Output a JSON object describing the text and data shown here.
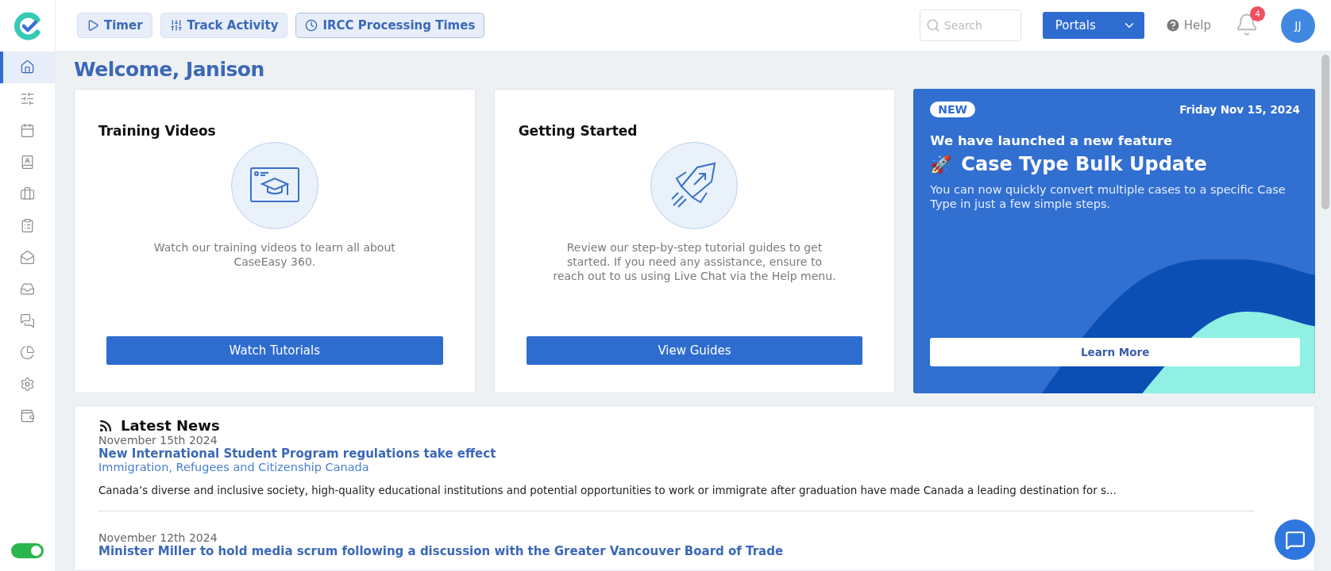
{
  "topbar": {
    "buttons": [
      {
        "kind": "timer",
        "label": "Timer"
      },
      {
        "kind": "activity",
        "label": "Track Activity"
      },
      {
        "kind": "clock",
        "label": "IRCC Processing Times"
      }
    ],
    "search": {
      "placeholder": "Search"
    },
    "portals": {
      "label": "Portals"
    },
    "help": {
      "label": "Help"
    },
    "notifications": {
      "count": "4"
    },
    "avatar": {
      "initials": "JJ"
    }
  },
  "sidebar": {
    "items": [
      {
        "kind": "home",
        "selected": true
      },
      {
        "kind": "sliders",
        "selected": false
      },
      {
        "kind": "calendar",
        "selected": false
      },
      {
        "kind": "contacts",
        "selected": false
      },
      {
        "kind": "briefcase",
        "selected": false
      },
      {
        "kind": "clipboard",
        "selected": false
      },
      {
        "kind": "mail",
        "selected": false
      },
      {
        "kind": "inbox",
        "selected": false
      },
      {
        "kind": "chat",
        "selected": false
      },
      {
        "kind": "chart",
        "selected": false
      },
      {
        "kind": "settings",
        "selected": false
      },
      {
        "kind": "wallet",
        "selected": false
      }
    ],
    "toggle": {
      "on": true
    }
  },
  "welcome": "Welcome, Janison",
  "cards": [
    {
      "kind": "video",
      "title": "Training Videos",
      "text": "Watch our training videos to learn all about CaseEasy 360.",
      "button": "Watch Tutorials"
    },
    {
      "kind": "rocket",
      "title": "Getting Started",
      "text": "Review our step-by-step tutorial guides to get started. If you need any assistance, ensure to reach out to us using Live Chat via the Help menu.",
      "button": "View Guides"
    }
  ],
  "promo": {
    "badge": "NEW",
    "date": "Friday Nov 15, 2024",
    "eyebrow": "We have launched a new feature",
    "emoji": "🚀",
    "title": "Case Type Bulk Update",
    "text": "You can now quickly convert multiple cases to a specific Case Type in just a few simple steps.",
    "button": "Learn More"
  },
  "news": {
    "title": "Latest News",
    "items": [
      {
        "date": "November 15th 2024",
        "headline": "New International Student Program regulations take effect",
        "source": "Immigration, Refugees and Citizenship Canada",
        "summary": "Canada’s diverse and inclusive society, high-quality educational institutions and potential opportunities to work or immigrate after graduation have made Canada a leading destination for s..."
      },
      {
        "date": "November 12th 2024",
        "headline": "Minister Miller to hold media scrum following a discussion with the Greater Vancouver Board of Trade"
      }
    ]
  }
}
